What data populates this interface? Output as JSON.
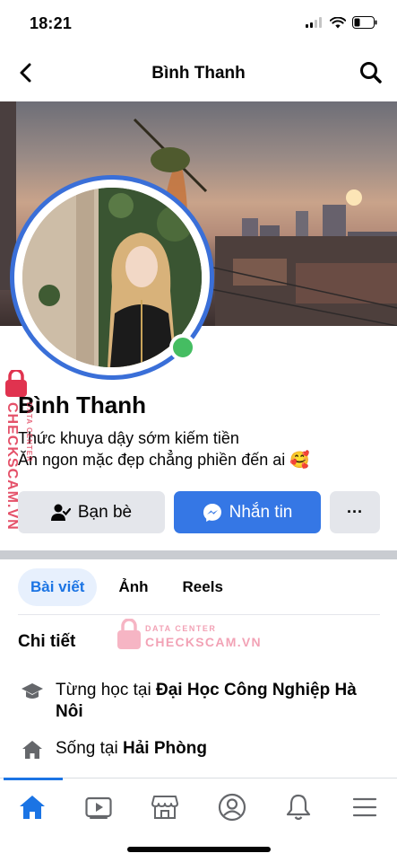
{
  "status_bar": {
    "time": "18:21"
  },
  "header": {
    "title": "Bình Thanh"
  },
  "profile": {
    "name": "Bình Thanh",
    "bio_line1": "Thức khuya dậy sớm kiếm tiền",
    "bio_line2": "Ăn ngon mặc đẹp chẳng phiền đến ai",
    "bio_emoji": "🥰",
    "online_color": "#45bd62"
  },
  "actions": {
    "friends_label": "Bạn bè",
    "message_label": "Nhắn tin",
    "more_label": "···"
  },
  "tabs": [
    {
      "label": "Bài viết"
    },
    {
      "label": "Ảnh"
    },
    {
      "label": "Reels"
    }
  ],
  "details": {
    "title": "Chi tiết",
    "study_prefix": "Từng học tại ",
    "study_place": "Đại Học Công Nghiệp Hà Nôi",
    "live_prefix": "Sống tại ",
    "live_place": "Hải Phòng"
  },
  "watermark": {
    "line1": "DATA CENTER",
    "line2": "CHECKSCAM.VN"
  },
  "bottom_nav": [
    {
      "icon": "home-icon"
    },
    {
      "icon": "video-icon"
    },
    {
      "icon": "marketplace-icon"
    },
    {
      "icon": "profile-icon"
    },
    {
      "icon": "bell-icon"
    },
    {
      "icon": "menu-icon"
    }
  ],
  "colors": {
    "accent": "#1b74e4",
    "message_button": "#3577e5",
    "avatar_ring": "#3a6fd8"
  }
}
